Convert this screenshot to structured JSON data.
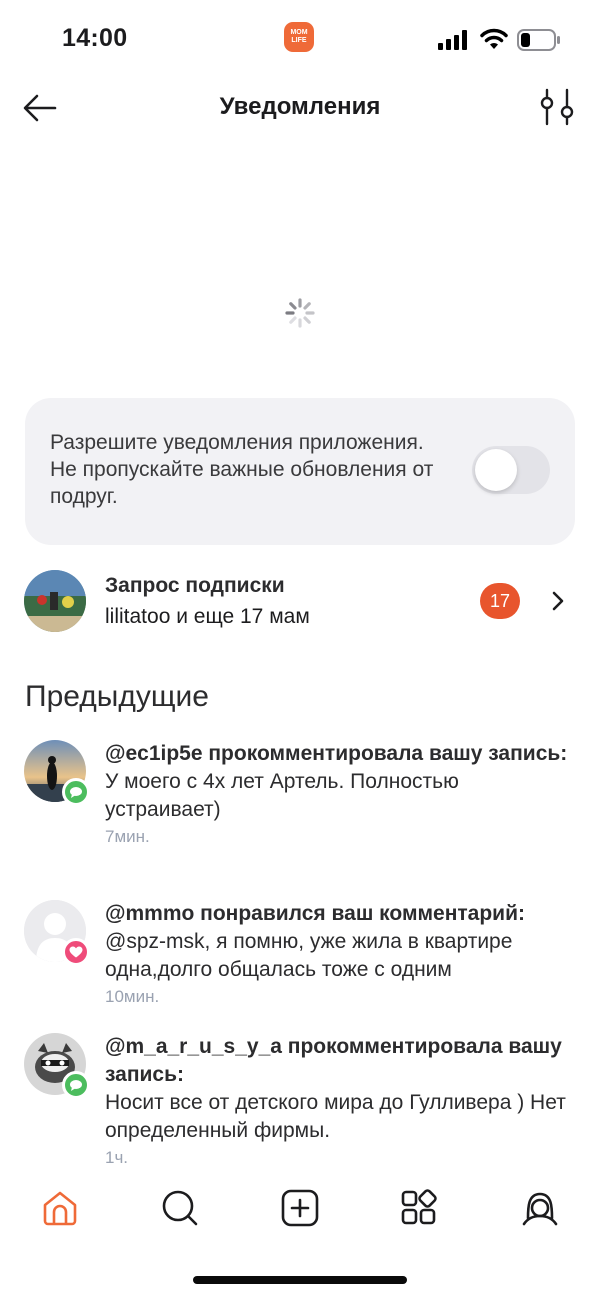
{
  "status_bar": {
    "time": "14:00",
    "app_logo_text": "MOM LIFE",
    "icons": [
      "cellular-signal-icon",
      "wifi-icon",
      "battery-icon"
    ]
  },
  "header": {
    "title": "Уведомления",
    "back_icon": "arrow-left-icon",
    "filter_icon": "sliders-icon"
  },
  "loading": {
    "icon": "spinner-icon"
  },
  "permission_card": {
    "text": "Разрешите уведомления приложения. Не пропускайте важные обновления от подруг.",
    "toggle_on": false
  },
  "subscription_request": {
    "title": "Запрос подписки",
    "subtitle": "lilitatoo и еще 17 мам",
    "count": "17"
  },
  "previous": {
    "title": "Предыдущие",
    "items": [
      {
        "header": "@ec1ip5e прокомментировала вашу запись:",
        "text": "У моего с 4х лет Артель. Полностью устраивает)",
        "time": "7мин.",
        "badge": "comment-icon"
      },
      {
        "header": "@mmmo понравился ваш комментарий:",
        "text": "@spz-msk, я помню, уже жила в квартире одна,долго общалась тоже с одним",
        "time": "10мин.",
        "badge": "heart-icon"
      },
      {
        "header": "@m_a_r_u_s_y_a прокомментировала вашу запись:",
        "text": "Носит все от детского мира до Гулливера ) Нет определенный фирмы.",
        "time": "1ч.",
        "badge": "comment-icon"
      }
    ]
  },
  "tab_bar": {
    "tabs": [
      "home-icon",
      "search-icon",
      "add-post-icon",
      "catalog-icon",
      "profile-icon"
    ],
    "active_tab": "home-icon",
    "accent_color": "#ef6a38"
  }
}
